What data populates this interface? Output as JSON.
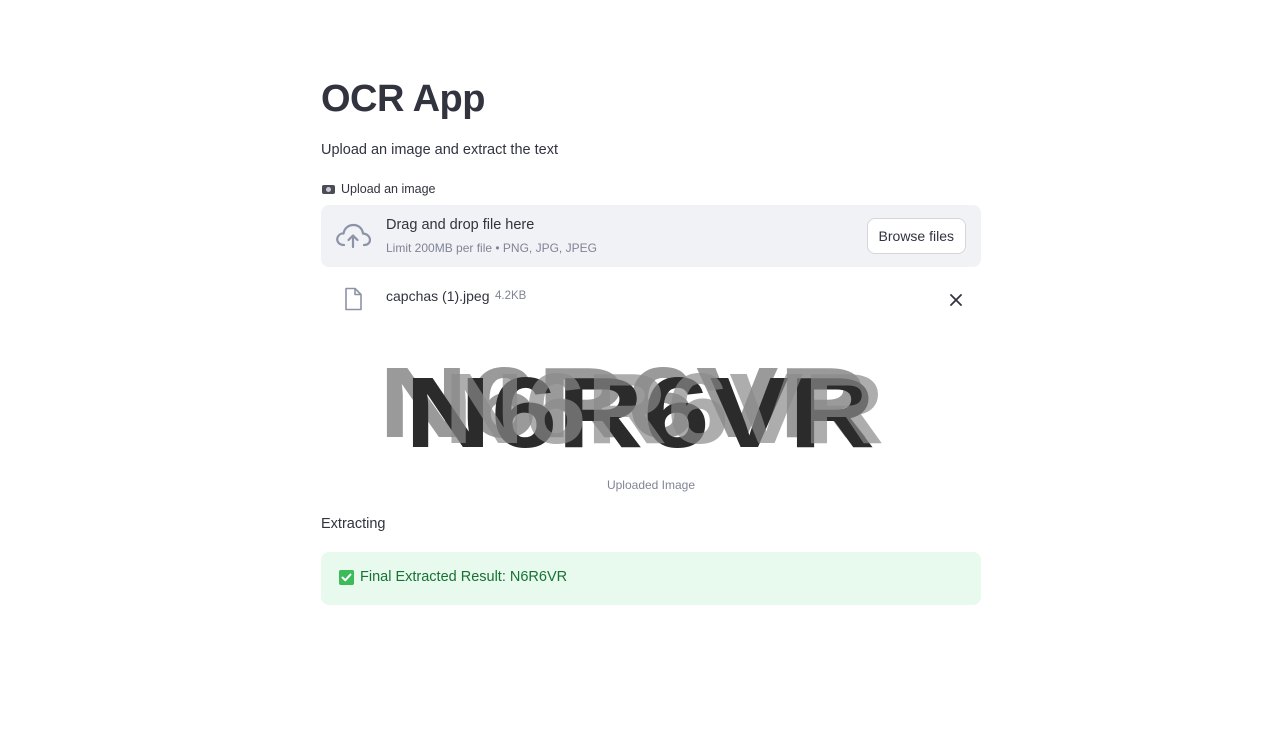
{
  "header": {
    "title": "OCR App",
    "subtitle": "Upload an image and extract the text"
  },
  "uploader": {
    "label_icon": "camera-icon",
    "label": "Upload an image",
    "dropzone_icon": "cloud-upload-icon",
    "drag_text": "Drag and drop file here",
    "limit_text": "Limit 200MB per file • PNG, JPG, JPEG",
    "browse_label": "Browse files"
  },
  "uploaded_file": {
    "icon": "file-icon",
    "name": "capchas (1).jpeg",
    "size": "4.2KB",
    "remove_icon": "close-icon"
  },
  "image": {
    "captcha_text": "N6R6VR",
    "caption": "Uploaded Image"
  },
  "status": {
    "extracting": "Extracting"
  },
  "result": {
    "icon": "check-icon",
    "text": "Final Extracted Result: N6R6VR"
  },
  "colors": {
    "text": "#31333f",
    "muted": "#808495",
    "dropzone_bg": "#f0f2f6",
    "success_bg": "#e8f9ee",
    "success_text": "#177233",
    "check": "#3dbb5b"
  }
}
